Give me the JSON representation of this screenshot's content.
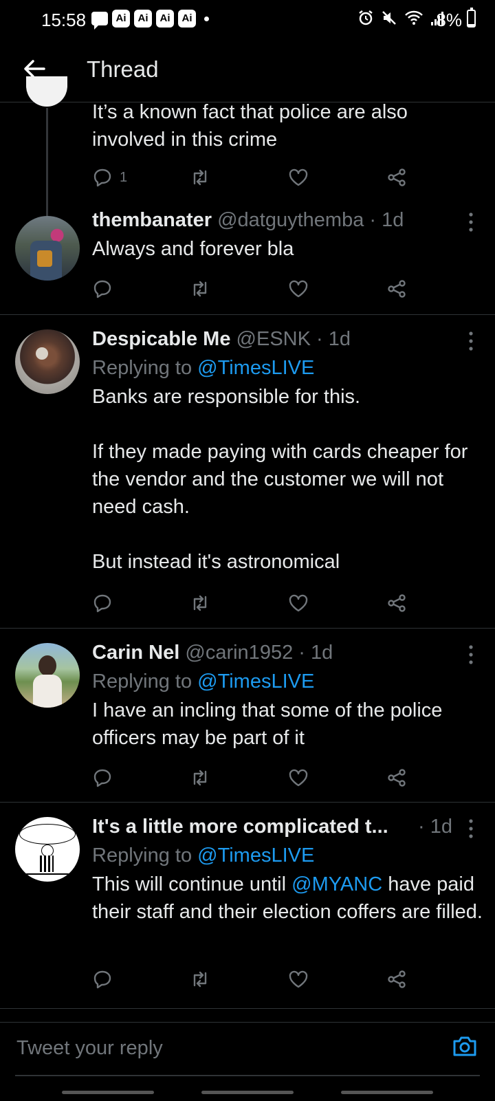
{
  "status_bar": {
    "time": "15:58",
    "ai_badges": [
      "Ai",
      "Ai",
      "Ai",
      "Ai"
    ],
    "battery": "8%"
  },
  "header": {
    "title": "Thread"
  },
  "tweets": [
    {
      "text_lines": [
        "It’s a known fact that police are also involved in this crime"
      ],
      "reply_count": "1"
    },
    {
      "name": "thembanater",
      "handle": "@datguythemba",
      "time": "1d",
      "text_lines": [
        "Always and forever bla"
      ]
    },
    {
      "name": "Despicable Me",
      "handle": "@ESNK",
      "time": "1d",
      "replying_label": "Replying to",
      "replying_to": "@TimesLIVE",
      "text_lines": [
        "Banks are responsible for this.",
        "If they made paying with cards cheaper for the vendor and the customer we will not need cash.",
        "But instead it's astronomical"
      ]
    },
    {
      "name": "Carin Nel",
      "handle": "@carin1952",
      "time": "1d",
      "replying_label": "Replying to",
      "replying_to": "@TimesLIVE",
      "text_lines": [
        "I have an incling that some of the police officers may be part of it"
      ]
    },
    {
      "name": "It's a little more complicated t...",
      "time": "1d",
      "replying_label": "Replying to",
      "replying_to": "@TimesLIVE",
      "text_before": "This will continue until ",
      "text_mention": "@MYANC",
      "text_after": " have paid their staff and their election coffers are filled."
    }
  ],
  "reply_bar": {
    "placeholder": "Tweet your reply"
  },
  "colors": {
    "background": "#000000",
    "text": "#e7e9ea",
    "muted": "#71767b",
    "accent": "#1d9bf0",
    "divider": "#2f3336"
  }
}
